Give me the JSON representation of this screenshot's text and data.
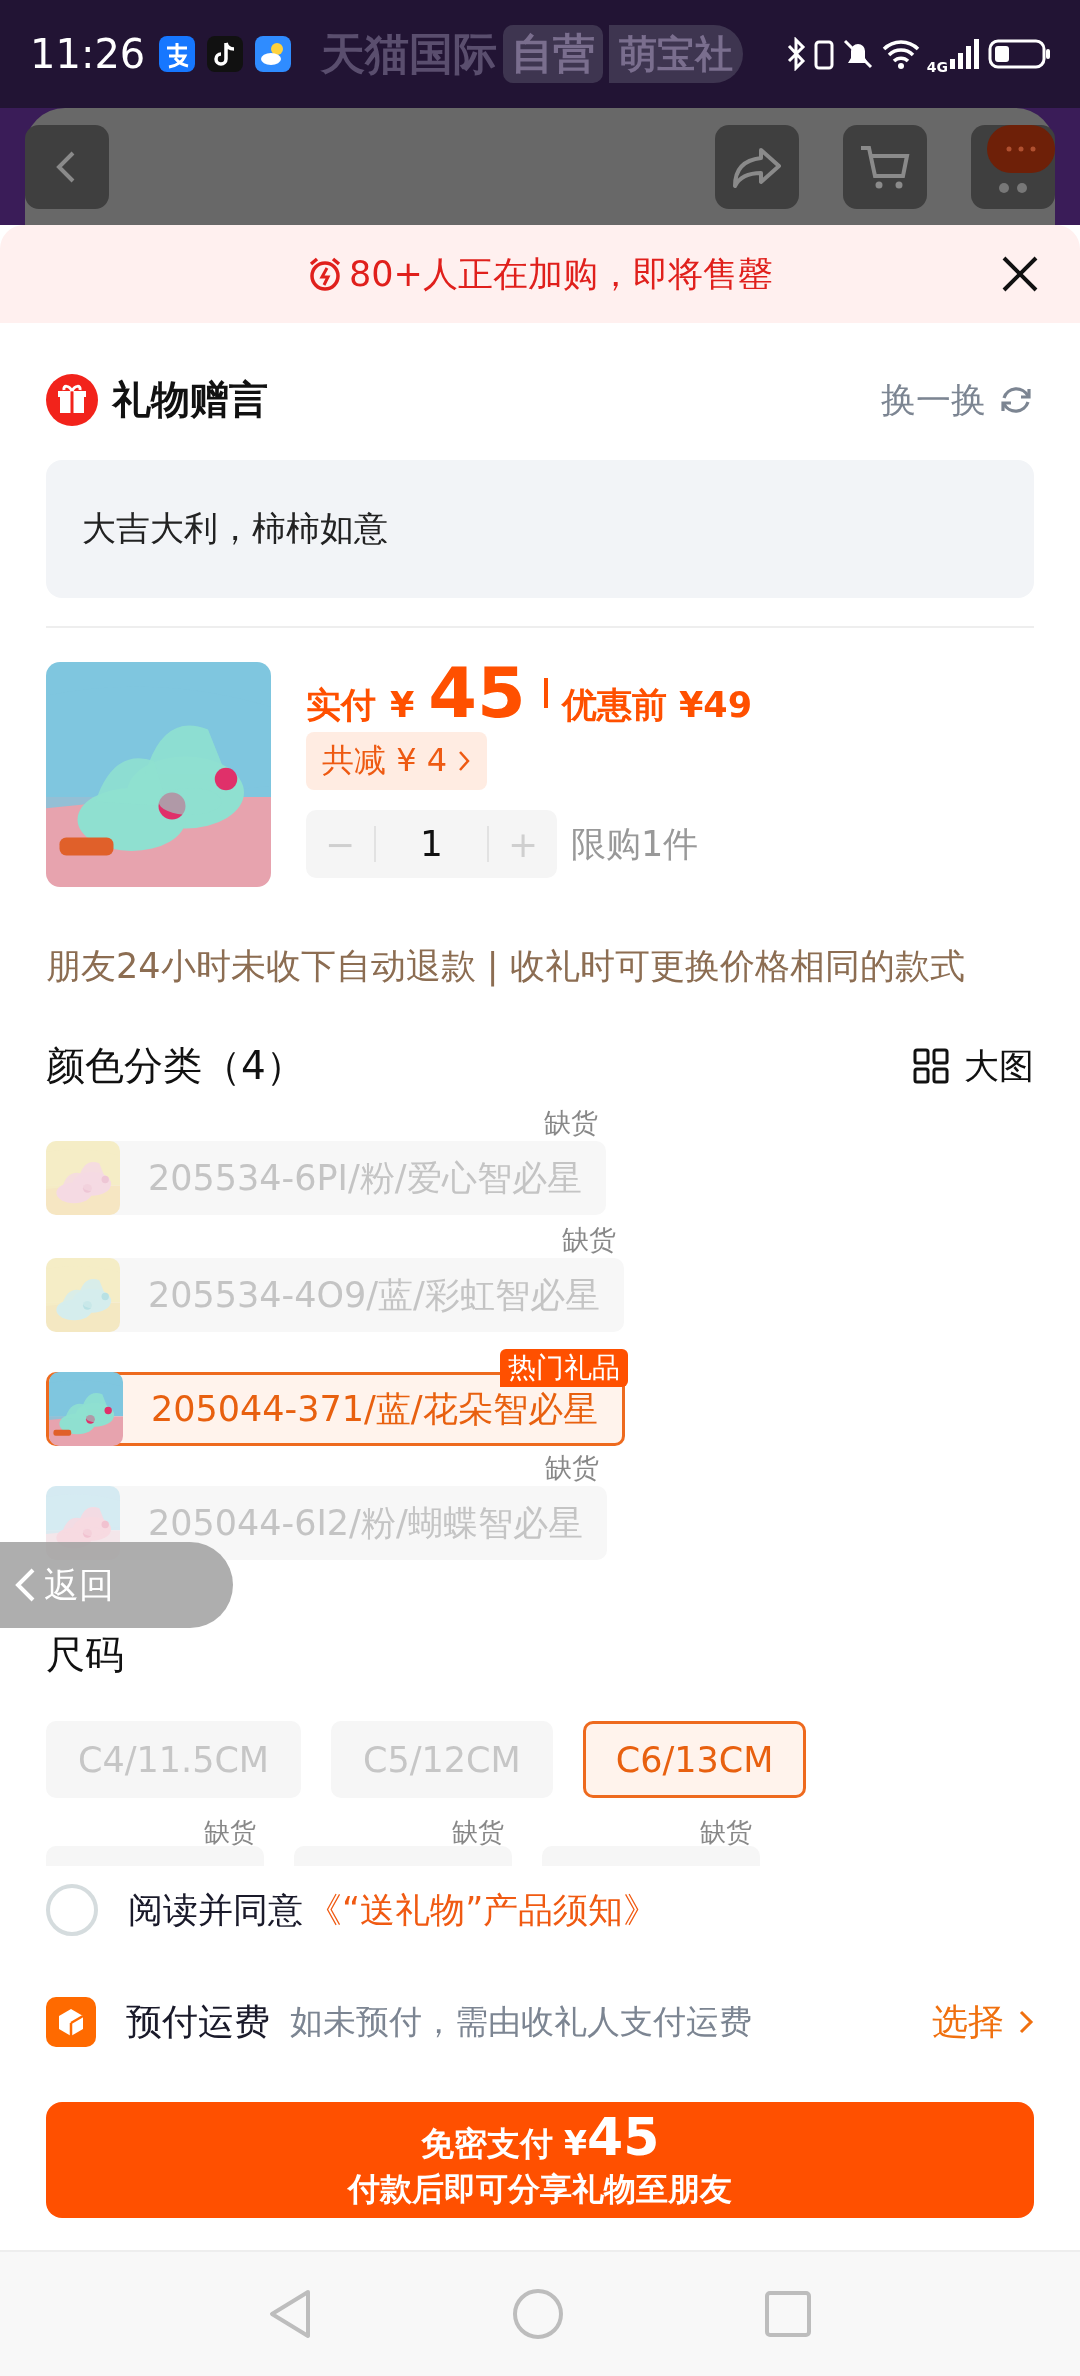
{
  "status_bar": {
    "time": "11:26",
    "network": "4G"
  },
  "store_banner": {
    "name": "天猫国际",
    "tag": "自营",
    "sub": "萌宝社"
  },
  "alert": {
    "text": "80+人正在加购，即将售罄"
  },
  "gift_message": {
    "title": "礼物赠言",
    "refresh": "换一换",
    "text": "大吉大利，柿柿如意"
  },
  "product": {
    "pay_label": "实付",
    "currency": "¥",
    "price": "45",
    "original_price": "优惠前 ¥49",
    "discount": "共减 ¥ 4",
    "quantity": {
      "minus": "−",
      "value": "1",
      "plus": "+",
      "minus_disabled": true,
      "plus_disabled": true
    },
    "limit": "限购1件"
  },
  "notice": "朋友24小时未收下自动退款 | 收礼时可更换价格相同的款式",
  "colors": {
    "title": "颜色分类（4）",
    "view_toggle": "大图",
    "items": [
      {
        "label": "205534-6PI/粉/爱心智必星",
        "selected": false,
        "disabled": true,
        "badge": {
          "kind": "stock",
          "text": "缺货"
        }
      },
      {
        "label": "205534-4O9/蓝/彩虹智必星",
        "selected": false,
        "disabled": true,
        "badge": {
          "kind": "stock",
          "text": "缺货"
        }
      },
      {
        "label": "205044-371/蓝/花朵智必星",
        "selected": true,
        "disabled": false,
        "badge": {
          "kind": "hot",
          "text": "热门礼品"
        }
      },
      {
        "label": "205044-6I2/粉/蝴蝶智必星",
        "selected": false,
        "disabled": true,
        "badge": {
          "kind": "stock",
          "text": "缺货"
        }
      }
    ]
  },
  "sizes": {
    "title": "尺码",
    "items": [
      {
        "label": "C4/11.5CM",
        "selected": false,
        "disabled": true
      },
      {
        "label": "C5/12CM",
        "selected": false,
        "disabled": true
      },
      {
        "label": "C6/13CM",
        "selected": true,
        "disabled": false
      },
      {
        "selected": false,
        "disabled": true,
        "badge": {
          "kind": "stock",
          "text": "缺货"
        }
      },
      {
        "selected": false,
        "disabled": true,
        "badge": {
          "kind": "stock",
          "text": "缺货"
        }
      },
      {
        "selected": false,
        "disabled": true,
        "badge": {
          "kind": "stock",
          "text": "缺货"
        }
      }
    ]
  },
  "agreement": {
    "checked": false,
    "text": "阅读并同意",
    "link": "《“送礼物”产品须知》"
  },
  "shipping": {
    "title": "预付运费",
    "hint": "如未预付，需由收礼人支付运费",
    "action": "选择"
  },
  "pay_button": {
    "label": "免密支付",
    "currency": "¥",
    "amount": "45",
    "subtitle": "付款后即可分享礼物至朋友"
  },
  "back_float": {
    "label": "返回"
  }
}
